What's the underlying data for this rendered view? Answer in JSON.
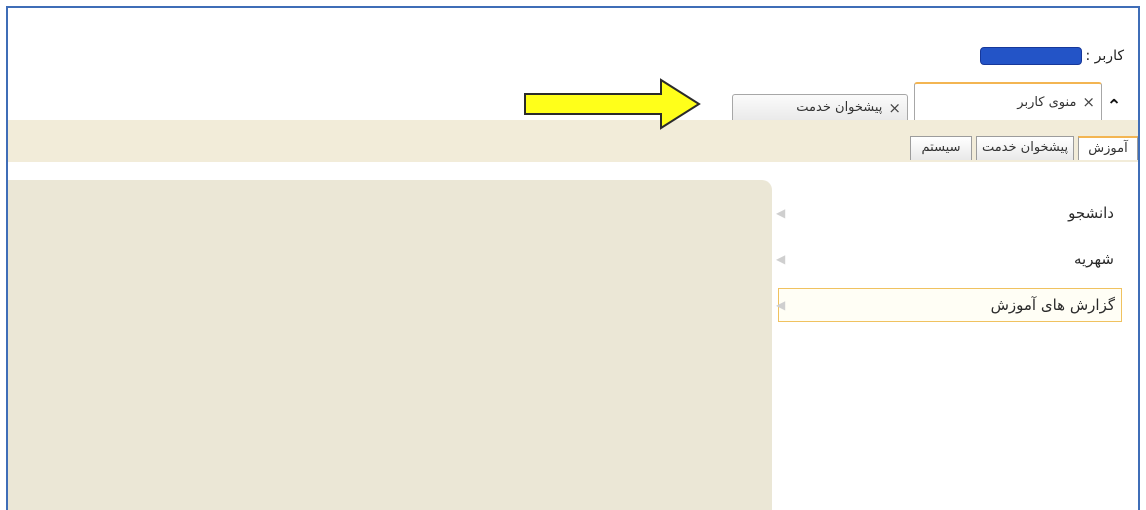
{
  "header": {
    "user_label": "کاربر :"
  },
  "tabs": [
    {
      "label": "منوی کاربر",
      "active": true
    },
    {
      "label": "پیشخوان خدمت",
      "active": false
    }
  ],
  "sub_tabs": [
    {
      "label": "آموزش",
      "active": true
    },
    {
      "label": "پیشخوان خدمت",
      "active": false
    },
    {
      "label": "سیستم",
      "active": false
    }
  ],
  "menu_items": [
    {
      "label": "دانشجو"
    },
    {
      "label": "شهریه"
    },
    {
      "label": "گزارش های آموزش",
      "selected": true
    }
  ],
  "colors": {
    "frame_border": "#3f6db7",
    "accent_tab": "#f3b552",
    "panel": "#ebe7d6",
    "annotation_arrow": "#ffff1a",
    "redact": "#2354c7"
  },
  "icons": {
    "close": "close-icon",
    "collapse": "double-chevron-up-icon",
    "submenu": "triangle-left-icon"
  }
}
